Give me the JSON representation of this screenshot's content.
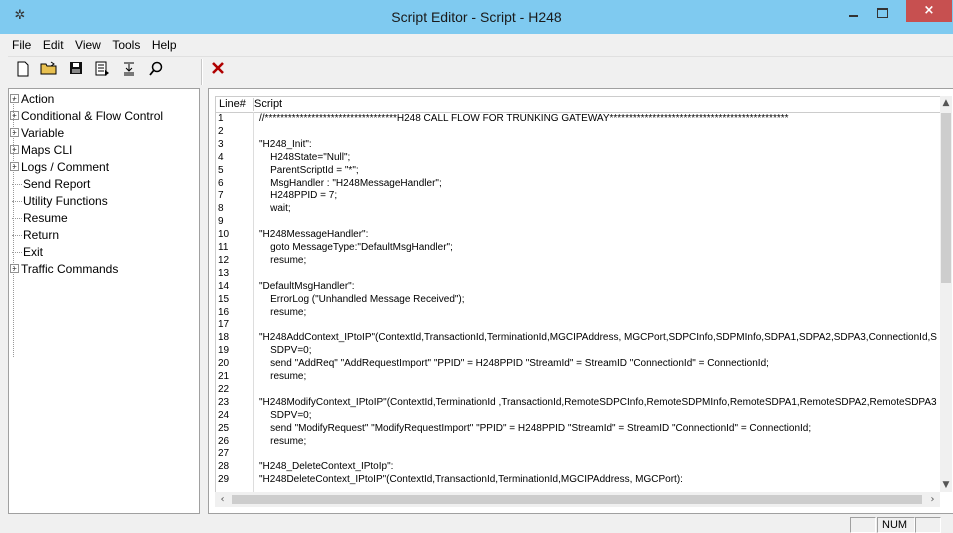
{
  "window": {
    "title": "Script Editor - Script - H248",
    "close_glyph": "×"
  },
  "menu": [
    "File",
    "Edit",
    "View",
    "Tools",
    "Help"
  ],
  "toolbar": {
    "icons": [
      "new-file-icon",
      "open-folder-icon",
      "save-icon",
      "properties-icon",
      "insert-lines-icon",
      "find-icon",
      "delete-icon"
    ]
  },
  "tree": {
    "items": [
      {
        "label": "Action",
        "expandable": true
      },
      {
        "label": "Conditional & Flow Control",
        "expandable": true
      },
      {
        "label": "Variable",
        "expandable": true
      },
      {
        "label": "Maps CLI",
        "expandable": true
      },
      {
        "label": "Logs / Comment",
        "expandable": true
      },
      {
        "label": "Send Report",
        "expandable": false
      },
      {
        "label": "Utility Functions",
        "expandable": false
      },
      {
        "label": "Resume",
        "expandable": false
      },
      {
        "label": "Return",
        "expandable": false
      },
      {
        "label": "Exit",
        "expandable": false
      },
      {
        "label": "Traffic Commands",
        "expandable": true
      }
    ]
  },
  "editor": {
    "header": {
      "line_col": "Line#",
      "script_col": "Script"
    },
    "lines": [
      {
        "n": "1",
        "code": "//**********************************H248 CALL FLOW FOR TRUNKING GATEWAY**********************************************"
      },
      {
        "n": "2",
        "code": ""
      },
      {
        "n": "3",
        "code": "\"H248_Init\":"
      },
      {
        "n": "4",
        "code": "    H248State=\"Null\";"
      },
      {
        "n": "5",
        "code": "    ParentScriptId = \"*\";"
      },
      {
        "n": "6",
        "code": "    MsgHandler : \"H248MessageHandler\";"
      },
      {
        "n": "7",
        "code": "    H248PPID = 7;"
      },
      {
        "n": "8",
        "code": "    wait;"
      },
      {
        "n": "9",
        "code": ""
      },
      {
        "n": "10",
        "code": "\"H248MessageHandler\":"
      },
      {
        "n": "11",
        "code": "    goto MessageType:\"DefaultMsgHandler\";"
      },
      {
        "n": "12",
        "code": "    resume;"
      },
      {
        "n": "13",
        "code": ""
      },
      {
        "n": "14",
        "code": "\"DefaultMsgHandler\":"
      },
      {
        "n": "15",
        "code": "    ErrorLog (\"Unhandled Message Received\");"
      },
      {
        "n": "16",
        "code": "    resume;"
      },
      {
        "n": "17",
        "code": ""
      },
      {
        "n": "18",
        "code": "\"H248AddContext_IPtoIP\"(ContextId,TransactionId,TerminationId,MGCIPAddress, MGCPort,SDPCInfo,SDPMInfo,SDPA1,SDPA2,SDPA3,ConnectionId,S"
      },
      {
        "n": "19",
        "code": "    SDPV=0;"
      },
      {
        "n": "20",
        "code": "    send \"AddReq\" \"AddRequestImport\" \"PPID\" = H248PPID \"StreamId\" = StreamID \"ConnectionId\" = ConnectionId;"
      },
      {
        "n": "21",
        "code": "    resume;"
      },
      {
        "n": "22",
        "code": ""
      },
      {
        "n": "23",
        "code": "\"H248ModifyContext_IPtoIP\"(ContextId,TerminationId ,TransactionId,RemoteSDPCInfo,RemoteSDPMInfo,RemoteSDPA1,RemoteSDPA2,RemoteSDPA3"
      },
      {
        "n": "24",
        "code": "    SDPV=0;"
      },
      {
        "n": "25",
        "code": "    send \"ModifyRequest\" \"ModifyRequestImport\" \"PPID\" = H248PPID \"StreamId\" = StreamID \"ConnectionId\" = ConnectionId;"
      },
      {
        "n": "26",
        "code": "    resume;"
      },
      {
        "n": "27",
        "code": ""
      },
      {
        "n": "28",
        "code": "\"H248_DeleteContext_IPtoIp\":"
      },
      {
        "n": "29",
        "code": "\"H248DeleteContext_IPtoIP\"(ContextId,TransactionId,TerminationId,MGCIPAddress, MGCPort):"
      }
    ]
  },
  "status": {
    "num": "NUM"
  }
}
